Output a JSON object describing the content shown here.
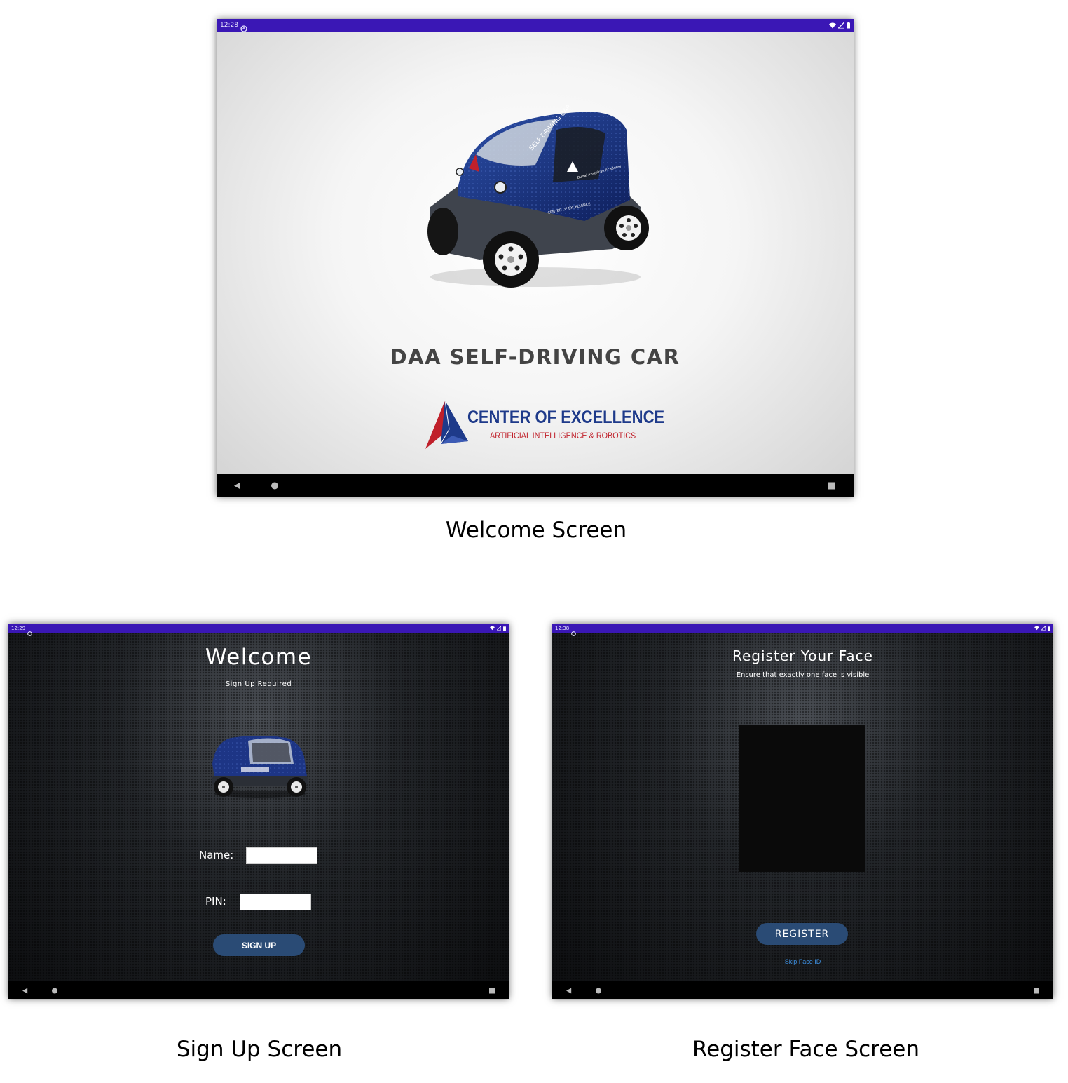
{
  "welcome_screen": {
    "status_time": "12:28",
    "title": "DAA SELF-DRIVING CAR",
    "logo_title": "CENTER OF EXCELLENCE",
    "logo_subtitle": "ARTIFICIAL INTELLIGENCE & ROBOTICS",
    "car_text_1": "SELF DRIVING CAR",
    "car_text_2": "CENTER OF EXCELLENCE",
    "car_text_3": "Dubai American Academy",
    "caption": "Welcome Screen"
  },
  "signup_screen": {
    "status_time": "12:29",
    "title": "Welcome",
    "subtitle": "Sign Up Required",
    "name_label": "Name:",
    "name_value": "",
    "pin_label": "PIN:",
    "pin_value": "",
    "signup_button": "SIGN UP",
    "caption": "Sign Up Screen"
  },
  "register_screen": {
    "status_time": "12:38",
    "title": "Register Your Face",
    "subtitle": "Ensure that exactly one face is visible",
    "register_button": "REGISTER",
    "skip_link": "Skip Face ID",
    "caption": "Register Face Screen"
  },
  "colors": {
    "status_bar": "#3a17b5",
    "button": "#2a4b75",
    "link": "#3d8fe0",
    "logo_blue": "#1e3a8a",
    "logo_red": "#c0202a"
  },
  "icons": [
    "wifi-icon",
    "signal-icon",
    "battery-icon",
    "back-icon",
    "home-icon",
    "recents-icon",
    "sync-icon"
  ]
}
